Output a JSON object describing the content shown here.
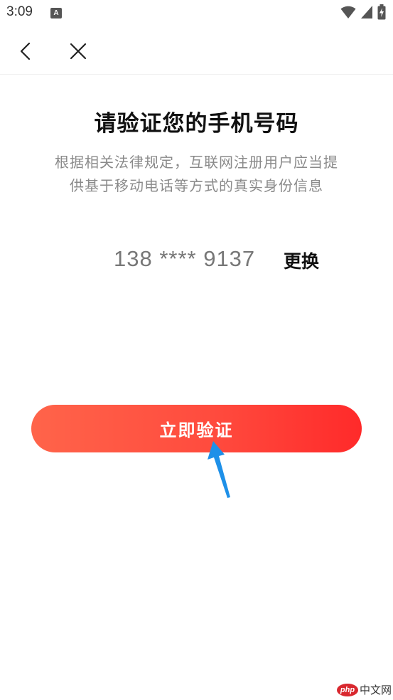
{
  "status_bar": {
    "time": "3:09",
    "app_icon_letter": "A",
    "icons": [
      "wifi-icon",
      "cellular-signal-icon",
      "battery-charging-icon"
    ]
  },
  "nav": {
    "back_icon": "chevron-left-icon",
    "close_icon": "close-icon"
  },
  "main": {
    "title": "请验证您的手机号码",
    "subtitle_line1": "根据相关法律规定，互联网注册用户应当提",
    "subtitle_line2": "供基于移动电话等方式的真实身份信息",
    "phone_number": "138 **** 9137",
    "change_label": "更换",
    "verify_label": "立即验证"
  },
  "colors": {
    "button_gradient_start": "#ff644a",
    "button_gradient_end": "#ff2a2a",
    "annotation_arrow": "#1e90e8"
  },
  "watermark": {
    "logo_text": "php",
    "text": "中文网"
  }
}
